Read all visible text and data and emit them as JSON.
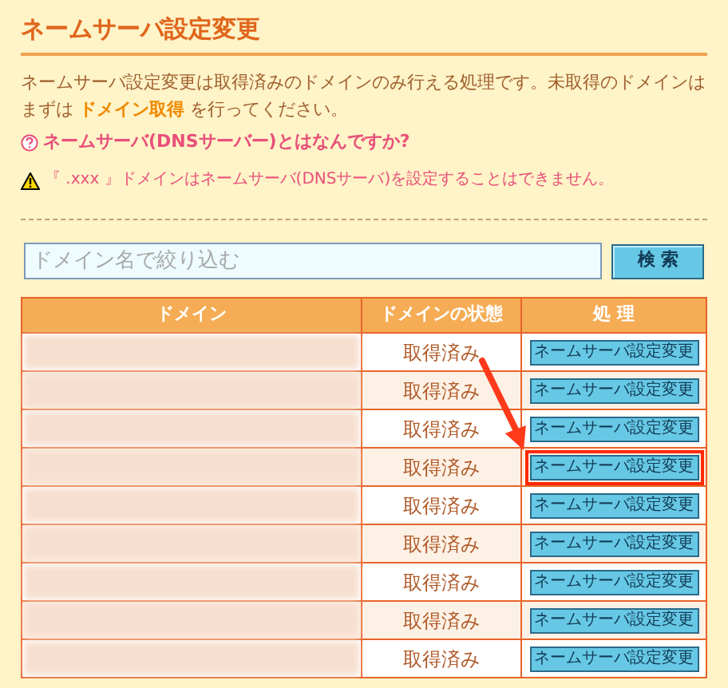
{
  "title": "ネームサーバ設定変更",
  "intro": {
    "before": "ネームサーバ設定変更は取得済みのドメインのみ行える処理です。未取得のドメインはまずは ",
    "link": "ドメイン取得",
    "after": " を行ってください。"
  },
  "help_link": "ネームサーバ(DNSサーバー)とはなんですか?",
  "warning": "『 .xxx 』ドメインはネームサーバ(DNSサーバ)を設定することはできません。",
  "search": {
    "placeholder": "ドメイン名で絞り込む",
    "button": "検 索"
  },
  "table": {
    "columns": [
      "ドメイン",
      "ドメインの状態",
      "処 理"
    ],
    "rows": [
      {
        "status": "取得済み",
        "action": "ネームサーバ設定変更",
        "highlighted": false
      },
      {
        "status": "取得済み",
        "action": "ネームサーバ設定変更",
        "highlighted": false
      },
      {
        "status": "取得済み",
        "action": "ネームサーバ設定変更",
        "highlighted": false
      },
      {
        "status": "取得済み",
        "action": "ネームサーバ設定変更",
        "highlighted": true
      },
      {
        "status": "取得済み",
        "action": "ネームサーバ設定変更",
        "highlighted": false
      },
      {
        "status": "取得済み",
        "action": "ネームサーバ設定変更",
        "highlighted": false
      },
      {
        "status": "取得済み",
        "action": "ネームサーバ設定変更",
        "highlighted": false
      },
      {
        "status": "取得済み",
        "action": "ネームサーバ設定変更",
        "highlighted": false
      },
      {
        "status": "取得済み",
        "action": "ネームサーバ設定変更",
        "highlighted": false
      }
    ]
  }
}
